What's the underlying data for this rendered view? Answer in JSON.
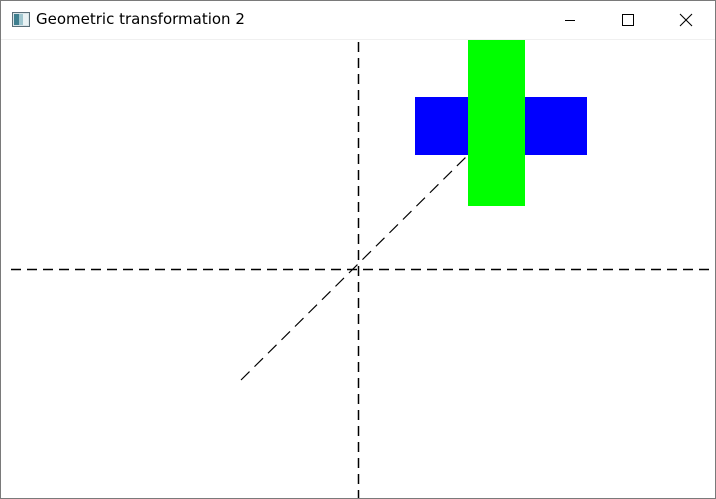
{
  "window": {
    "title": "Geometric transformation 2"
  },
  "titlebar_buttons": {
    "minimize_icon": "minimize-icon",
    "maximize_icon": "maximize-icon",
    "close_icon": "close-icon"
  },
  "scene": {
    "shapes": [
      {
        "name": "blue-rectangle",
        "color": "#0000ff"
      },
      {
        "name": "green-rectangle",
        "color": "#00ff00"
      }
    ],
    "axis_line_color": "#000000"
  }
}
